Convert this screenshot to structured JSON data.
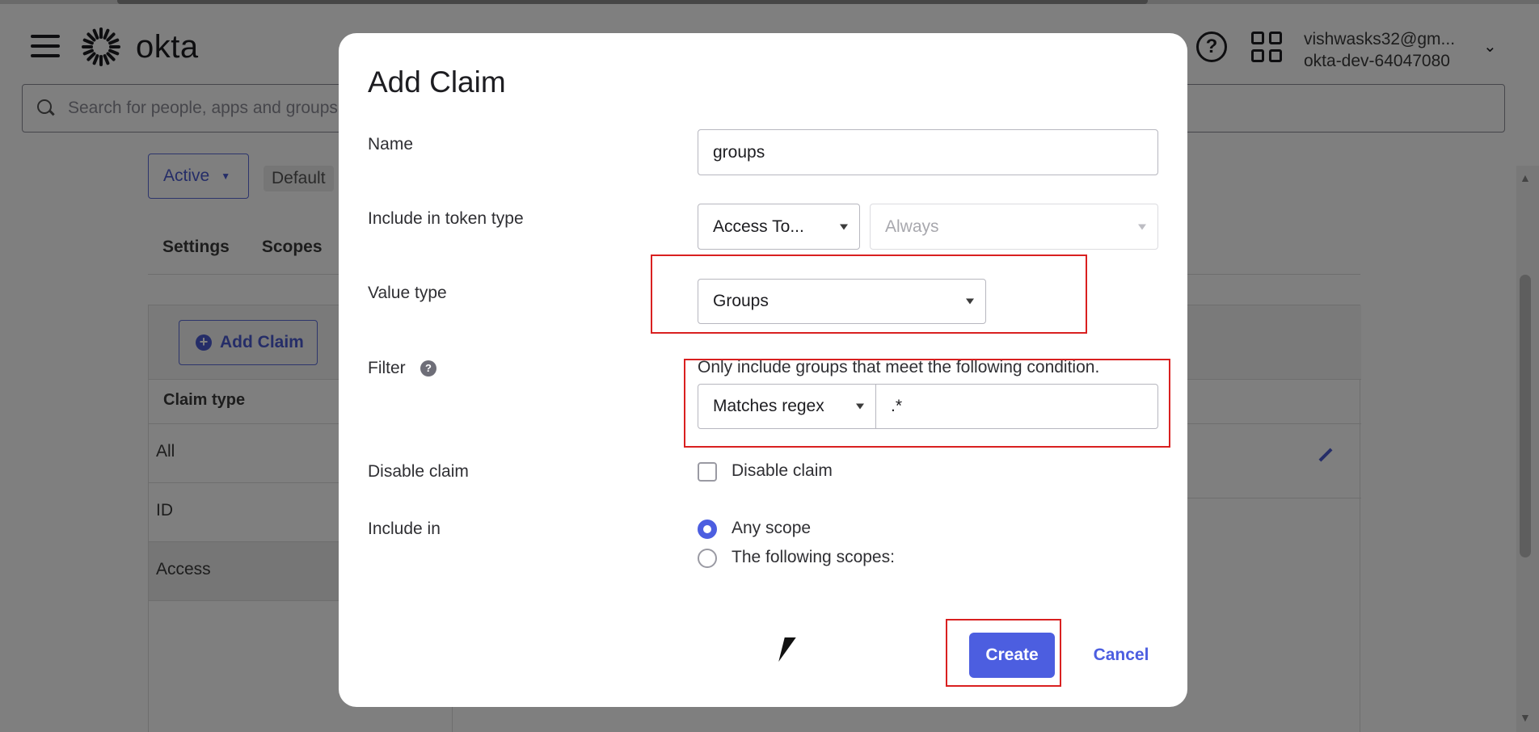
{
  "header": {
    "logo_text": "okta",
    "search_placeholder": "Search for people, apps and groups",
    "user_email": "vishwasks32@gm...",
    "user_org": "okta-dev-64047080"
  },
  "background": {
    "status_label": "Active",
    "default_chip": "Default",
    "tabs": [
      "Settings",
      "Scopes"
    ],
    "add_claim_label": "Add Claim",
    "claim_type_header": "Claim type",
    "claim_types": [
      "All",
      "ID",
      "Access"
    ]
  },
  "modal": {
    "title": "Add Claim",
    "name_label": "Name",
    "name_value": "groups",
    "token_type_label": "Include in token type",
    "token_type_value": "Access To...",
    "token_when_value": "Always",
    "value_type_label": "Value type",
    "value_type_value": "Groups",
    "filter_label": "Filter",
    "filter_help": "Only include groups that meet the following condition.",
    "filter_operator": "Matches regex",
    "filter_value": ".*",
    "disable_label": "Disable claim",
    "disable_checkbox_label": "Disable claim",
    "disable_checked": false,
    "include_in_label": "Include in",
    "include_options": [
      "Any scope",
      "The following scopes:"
    ],
    "include_selected": "Any scope",
    "create_label": "Create",
    "cancel_label": "Cancel"
  },
  "colors": {
    "primary": "#4c5ee0",
    "highlight": "#d92020"
  }
}
